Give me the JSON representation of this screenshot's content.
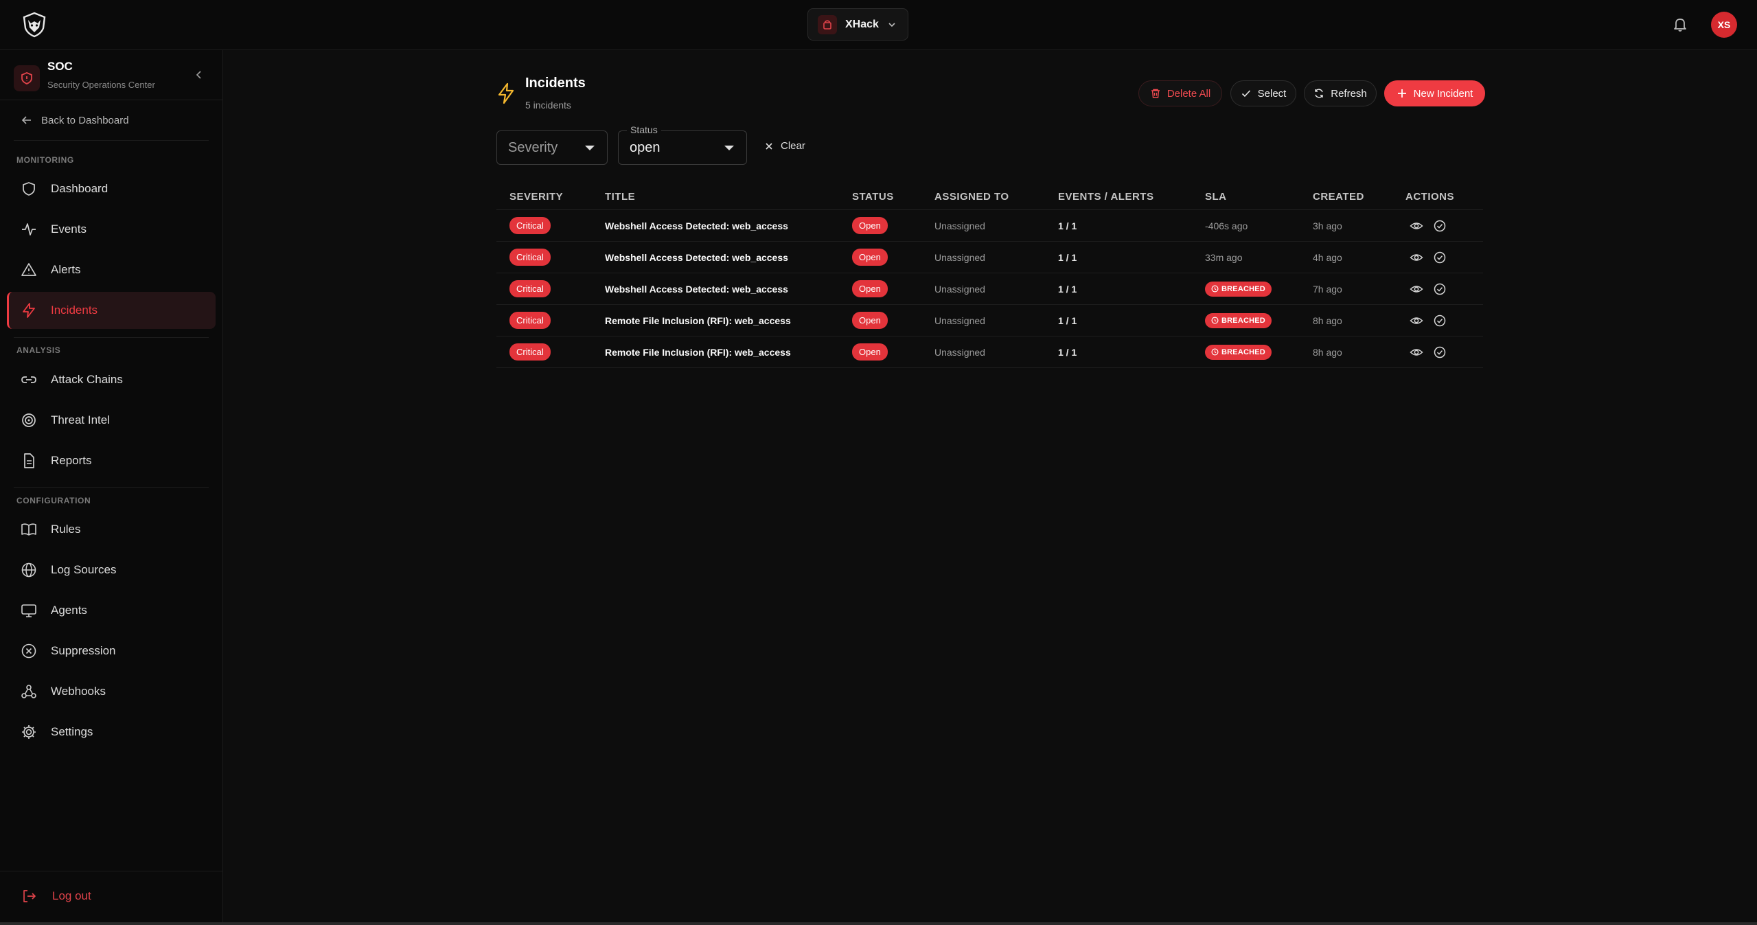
{
  "topbar": {
    "org_name": "XHack",
    "avatar_initials": "XS"
  },
  "sidebar": {
    "header_title": "SOC",
    "header_subtitle": "Security Operations Center",
    "back_label": "Back to Dashboard",
    "sections": {
      "monitoring": "MONITORING",
      "analysis": "ANALYSIS",
      "configuration": "CONFIGURATION"
    },
    "items": {
      "dashboard": "Dashboard",
      "events": "Events",
      "alerts": "Alerts",
      "incidents": "Incidents",
      "attack_chains": "Attack Chains",
      "threat_intel": "Threat Intel",
      "reports": "Reports",
      "rules": "Rules",
      "log_sources": "Log Sources",
      "agents": "Agents",
      "suppression": "Suppression",
      "webhooks": "Webhooks",
      "settings": "Settings"
    },
    "active_item": "incidents",
    "logout_label": "Log out"
  },
  "page": {
    "title": "Incidents",
    "count": "5 incidents"
  },
  "toolbar": {
    "delete_all": "Delete All",
    "select": "Select",
    "refresh": "Refresh",
    "new_incident": "New Incident"
  },
  "filters": {
    "severity_placeholder": "Severity",
    "status_label": "Status",
    "status_value": "open",
    "clear": "Clear"
  },
  "table": {
    "columns": {
      "severity": "SEVERITY",
      "title": "TITLE",
      "status": "STATUS",
      "assigned": "ASSIGNED TO",
      "events": "EVENTS / ALERTS",
      "sla": "SLA",
      "created": "CREATED",
      "actions": "ACTIONS"
    },
    "rows": [
      {
        "severity": "Critical",
        "title": "Webshell Access Detected: web_access",
        "status": "Open",
        "assigned": "Unassigned",
        "events": "1 / 1",
        "sla": "-406s ago",
        "sla_breached": false,
        "created": "3h ago"
      },
      {
        "severity": "Critical",
        "title": "Webshell Access Detected: web_access",
        "status": "Open",
        "assigned": "Unassigned",
        "events": "1 / 1",
        "sla": "33m ago",
        "sla_breached": false,
        "created": "4h ago"
      },
      {
        "severity": "Critical",
        "title": "Webshell Access Detected: web_access",
        "status": "Open",
        "assigned": "Unassigned",
        "events": "1 / 1",
        "sla": "BREACHED",
        "sla_breached": true,
        "created": "7h ago"
      },
      {
        "severity": "Critical",
        "title": "Remote File Inclusion (RFI): web_access",
        "status": "Open",
        "assigned": "Unassigned",
        "events": "1 / 1",
        "sla": "BREACHED",
        "sla_breached": true,
        "created": "8h ago"
      },
      {
        "severity": "Critical",
        "title": "Remote File Inclusion (RFI): web_access",
        "status": "Open",
        "assigned": "Unassigned",
        "events": "1 / 1",
        "sla": "BREACHED",
        "sla_breached": true,
        "created": "8h ago"
      }
    ]
  },
  "colors": {
    "accent": "#ef3b42",
    "background": "#0d0d0d",
    "sidebar": "#0a0a0a",
    "incident_icon": "#f5b82e"
  },
  "icons": {
    "logo": "wolf-shield-logo",
    "notifications": "bell-icon",
    "incidents": "lightning-icon",
    "view": "eye-icon",
    "resolve": "check-circle-icon"
  }
}
